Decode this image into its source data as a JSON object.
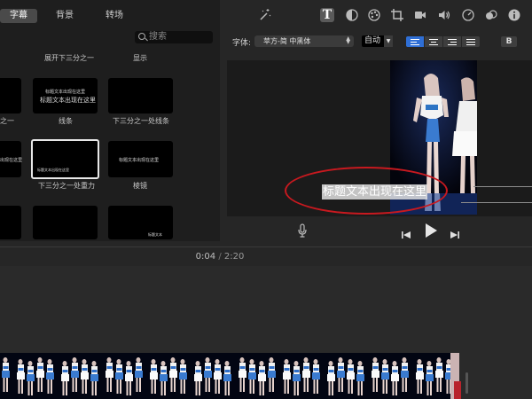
{
  "library": {
    "tabs": [
      {
        "label": "字幕",
        "active": true
      },
      {
        "label": "背景",
        "active": false
      },
      {
        "label": "转场",
        "active": false
      }
    ],
    "search_placeholder": "搜索",
    "captions": {
      "c1": "展开下三分之一",
      "c2": "显示",
      "c3": "线条",
      "c4": "之一",
      "c5": "下三分之一处线条",
      "c6": "下三分之一处重力",
      "c7": "棱镜"
    },
    "thumb_texts": {
      "t1a": "标题文本出现在这里",
      "t1b": "标题文本出现在这里",
      "t2": "出现在这里",
      "t3": "标题文本出现在这里",
      "t4": "标题文本出现在这里",
      "t5": "标题文本"
    }
  },
  "inspector": {
    "font_label": "字体:",
    "font_value": "苹方-简 中黑体",
    "size_value": "自动",
    "bold_label": "B",
    "active_alignment": "left"
  },
  "preview": {
    "title_text": "标题文本出现在这里",
    "annotation_color": "#c8191f"
  },
  "playback": {
    "current_time": "0:04",
    "separator": "/",
    "total_time": "2:20"
  },
  "icons": [
    "magic-wand-icon",
    "text-icon",
    "color-icon",
    "palette-icon",
    "crop-icon",
    "camera-icon",
    "volume-icon",
    "speed-icon",
    "filter-icon",
    "info-icon",
    "mic-icon",
    "skip-back-icon",
    "play-icon",
    "skip-forward-icon"
  ]
}
